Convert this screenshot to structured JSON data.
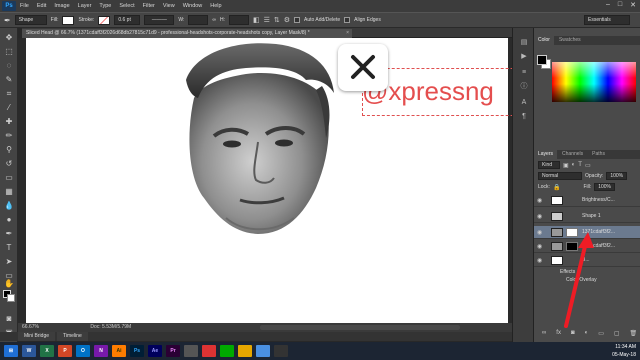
{
  "menu": {
    "app_badge": "Ps",
    "items": [
      "File",
      "Edit",
      "Image",
      "Layer",
      "Type",
      "Select",
      "Filter",
      "View",
      "Window",
      "Help"
    ]
  },
  "options": {
    "tool_mode": "Shape",
    "fill_label": "Fill:",
    "stroke_label": "Stroke:",
    "stroke_width": "0.6 pt",
    "w_label": "W:",
    "h_label": "H:",
    "auto_add_delete": "Auto Add/Delete",
    "align_edges": "Align Edges",
    "workspace": "Essentials"
  },
  "document": {
    "tab_title": "Sliced Head @ 66.7% (1371cdaff3f2026d68db27815c71d9 - professional-headshots-corporate-headshots copy, Layer Mask/8) *",
    "zoom": "66.67%",
    "doc_size": "Doc: 5.53M/5.79M"
  },
  "bottom_tabs": [
    "Mini Bridge",
    "Timeline"
  ],
  "panels": {
    "color_tabs": [
      "Color",
      "Swatches"
    ],
    "layers_tabs": [
      "Layers",
      "Channels",
      "Paths"
    ],
    "kind_label": "Kind",
    "blend_mode": "Normal",
    "opacity_label": "Opacity:",
    "opacity_value": "100%",
    "lock_label": "Lock:",
    "fill_label": "Fill:",
    "fill_value": "100%",
    "layers": [
      {
        "name": "Brightness/C..."
      },
      {
        "name": "Shape 1"
      },
      {
        "name": "1371cdaff3f2..."
      },
      {
        "name": "1371cdaff3f2..."
      },
      {
        "name": "B..."
      },
      {
        "name": "Effects"
      },
      {
        "name": "Color Overlay"
      }
    ]
  },
  "overlay": {
    "watermark": "@xpressng",
    "close_icon": "close-icon",
    "share_icon": "slashes-icon"
  },
  "taskbar": {
    "apps": [
      "W",
      "X",
      "P",
      "O",
      "N",
      "Ai",
      "Ps",
      "Ae",
      "Pr"
    ],
    "time": "11:34 AM",
    "date": "05-May-18"
  },
  "colors": {
    "accent_red": "#e03030",
    "ps_blue": "#31a8ff"
  }
}
